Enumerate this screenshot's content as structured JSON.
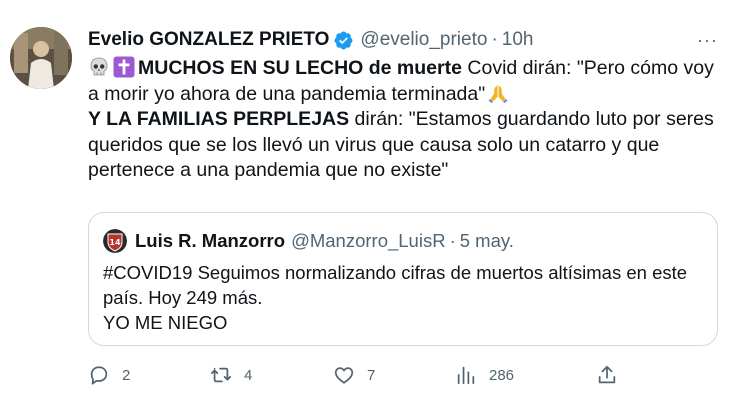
{
  "tweet": {
    "author_name": "Evelio GONZALEZ PRIETO",
    "author_handle": "@evelio_prieto",
    "separator": "·",
    "time": "10h",
    "verified_icon": "verified-badge-icon",
    "more_icon": "more-options-icon",
    "more_glyph": "···",
    "text": {
      "line1_bold": "MUCHOS EN SU LECHO de muerte",
      "line1_rest": " Covid dirán: \"Pero cómo voy a morir yo ahora de una pandemia terminada\"",
      "line2_bold": "Y LA FAMILIAS PERPLEJAS",
      "line2_rest": " dirán: \"Estamos guardando luto por seres queridos que se los llevó un virus que causa solo un catarro y que pertenece a una pandemia que no existe\""
    },
    "emojis": [
      "skull-emoji",
      "latin-cross-emoji",
      "folded-hands-emoji"
    ]
  },
  "quote": {
    "author_name": "Luis R. Manzorro",
    "author_handle": "@Manzorro_LuisR",
    "separator": "·",
    "time": "5 may.",
    "avatar_badge": "14",
    "line1": "#COVID19 Seguimos normalizando cifras de muertos altísimas en este país. Hoy 249 más.",
    "line2": "YO ME NIEGO"
  },
  "actions": {
    "reply_count": "2",
    "retweet_count": "4",
    "like_count": "7",
    "views_count": "286",
    "icons": [
      "reply-icon",
      "retweet-icon",
      "like-icon",
      "views-icon",
      "share-icon"
    ]
  },
  "colors": {
    "text": "#0f1419",
    "secondary": "#536471",
    "verified": "#1d9bf0",
    "border": "#cfd9de",
    "cross": "#9c59d1"
  }
}
